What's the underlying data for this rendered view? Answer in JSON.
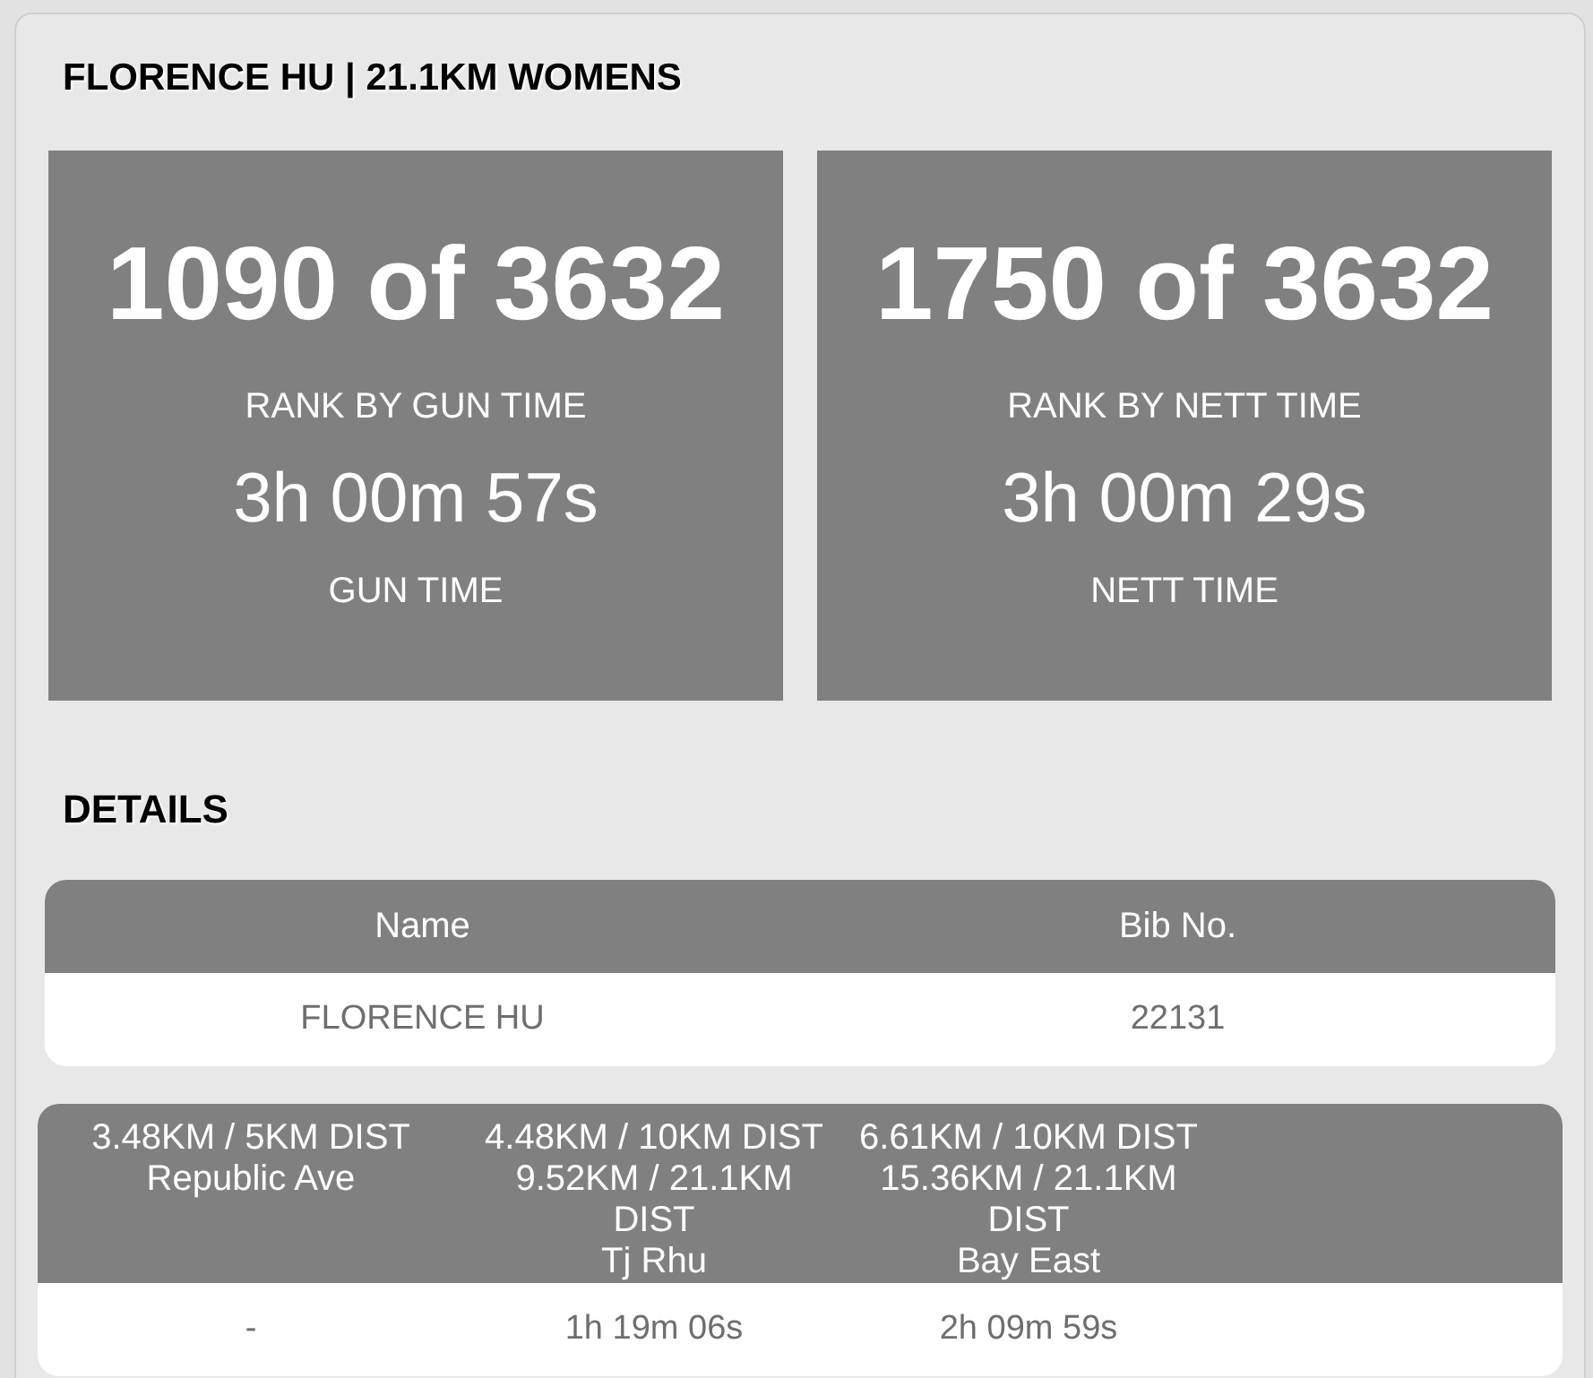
{
  "title": "FLORENCE HU | 21.1KM WOMENS",
  "stats": [
    {
      "rank": "1090 of 3632",
      "rank_label": "RANK BY GUN TIME",
      "time": "3h 00m 57s",
      "time_label": "GUN TIME"
    },
    {
      "rank": "1750 of 3632",
      "rank_label": "RANK BY NETT TIME",
      "time": "3h 00m 29s",
      "time_label": "NETT TIME"
    }
  ],
  "details": {
    "heading": "DETAILS",
    "columns": [
      "Name",
      "Bib No."
    ],
    "rows": [
      [
        "FLORENCE HU",
        "22131"
      ]
    ]
  },
  "splits": {
    "columns": [
      {
        "lines": [
          "3.48KM / 5KM DIST",
          "Republic Ave"
        ]
      },
      {
        "lines": [
          "4.48KM / 10KM DIST",
          "9.52KM / 21.1KM DIST",
          "Tj Rhu"
        ]
      },
      {
        "lines": [
          "6.61KM / 10KM DIST",
          "15.36KM / 21.1KM DIST",
          "Bay East"
        ]
      }
    ],
    "rows": [
      [
        "-",
        "1h 19m 06s",
        "2h 09m 59s"
      ]
    ]
  }
}
